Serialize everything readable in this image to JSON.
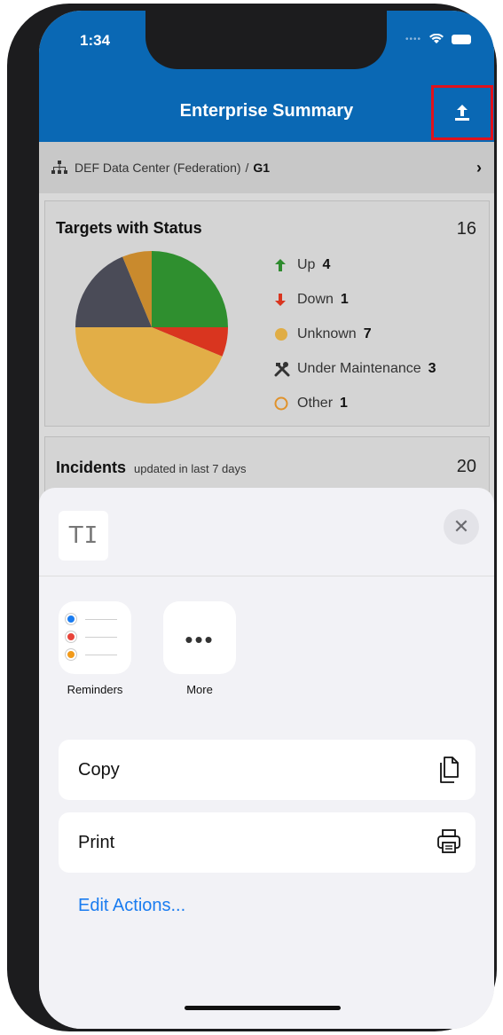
{
  "status_bar": {
    "time": "1:34"
  },
  "header": {
    "title": "Enterprise Summary",
    "share_icon": "share-upload-icon"
  },
  "breadcrumb": {
    "path": "DEF Data Center (Federation)",
    "separator": "/",
    "current": "G1"
  },
  "targets": {
    "title": "Targets with Status",
    "count": "16",
    "legend": [
      {
        "label": "Up",
        "count": "4",
        "color": "#2e8b2e",
        "icon": "arrow-up-icon"
      },
      {
        "label": "Down",
        "count": "1",
        "color": "#d9351f",
        "icon": "arrow-down-icon"
      },
      {
        "label": "Unknown",
        "count": "7",
        "color": "#e0ad45",
        "icon": "circle-filled-icon"
      },
      {
        "label": "Under Maintenance",
        "count": "3",
        "color": "#333333",
        "icon": "tools-icon"
      },
      {
        "label": "Other",
        "count": "1",
        "color": "#e0922b",
        "icon": "circle-outline-icon"
      }
    ],
    "pie_colors": {
      "up": "#2f8f2f",
      "down": "#d9351f",
      "unknown": "#e2ae47",
      "maintenance": "#4a4b57",
      "other": "#c98a2d"
    }
  },
  "incidents": {
    "title": "Incidents",
    "subtitle": "updated in last 7 days",
    "count": "20"
  },
  "share_sheet": {
    "text_thumb": "T",
    "apps": [
      {
        "label": "Reminders"
      },
      {
        "label": "More"
      }
    ],
    "actions": [
      {
        "label": "Copy"
      },
      {
        "label": "Print"
      }
    ],
    "edit_actions": "Edit Actions..."
  }
}
